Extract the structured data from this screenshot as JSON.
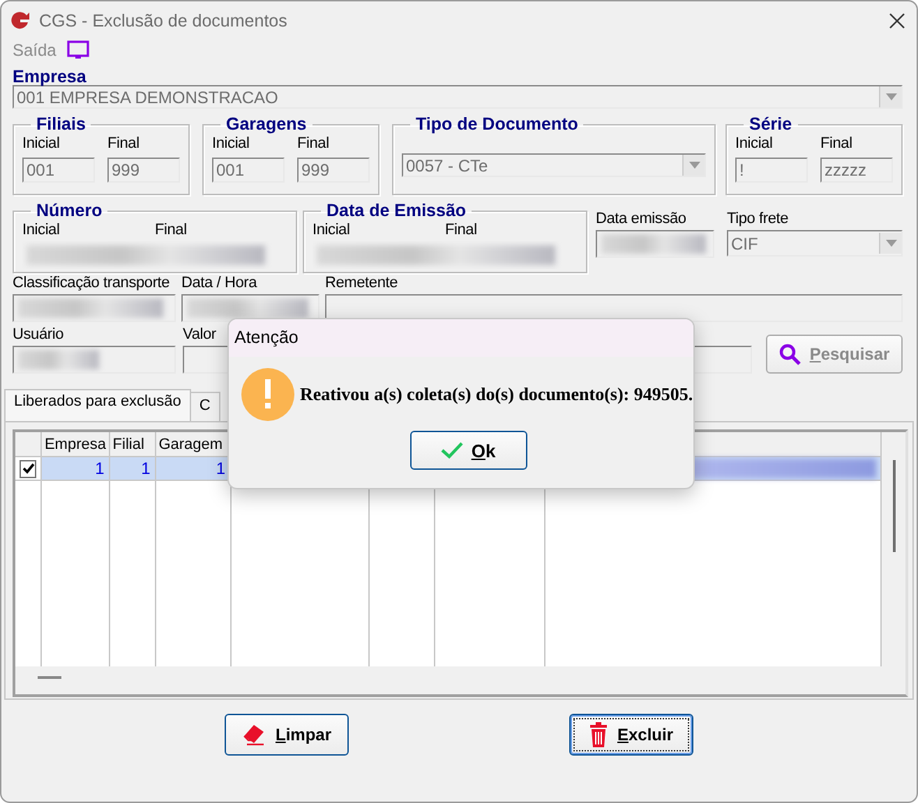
{
  "window": {
    "title": "CGS - Exclusão de documentos"
  },
  "menu": [
    {
      "label": "Saída"
    }
  ],
  "empresa": {
    "label": "Empresa",
    "value": "001 EMPRESA DEMONSTRACAO"
  },
  "ranges": [
    {
      "title": "Filiais",
      "fields": [
        {
          "label": "Inicial",
          "value": "001"
        },
        {
          "label": "Final",
          "value": "999"
        }
      ]
    },
    {
      "title": "Garagens",
      "fields": [
        {
          "label": "Inicial",
          "value": "001"
        },
        {
          "label": "Final",
          "value": "999"
        }
      ]
    }
  ],
  "tipo_documento": {
    "title": "Tipo de Documento",
    "value": "0057 - CTe"
  },
  "serie": {
    "title": "Série",
    "fields": [
      {
        "label": "Inicial",
        "value": "!"
      },
      {
        "label": "Final",
        "value": "zzzzz"
      }
    ]
  },
  "numero": {
    "title": "Número",
    "fields": [
      {
        "label": "Inicial"
      },
      {
        "label": "Final"
      }
    ]
  },
  "data_emissao_range": {
    "title": "Data de Emissão",
    "fields": [
      {
        "label": "Inicial"
      },
      {
        "label": "Final"
      }
    ]
  },
  "data_emissao": {
    "label": "Data emissão"
  },
  "tipo_frete": {
    "label": "Tipo frete",
    "value": "CIF"
  },
  "row_fields": [
    {
      "label": "Classificação transporte"
    },
    {
      "label": "Data / Hora"
    },
    {
      "label": "Remetente"
    }
  ],
  "usuario": {
    "label": "Usuário"
  },
  "valor": {
    "label": "Valor"
  },
  "search_button": "Pesquisar",
  "tabs": [
    {
      "label": "Liberados para exclusão",
      "selected": true
    },
    {
      "label": "C",
      "selected": false
    }
  ],
  "table": {
    "columns": [
      "Empresa",
      "Filial",
      "Garagem"
    ],
    "rows": [
      {
        "checked": true,
        "selected": true,
        "cells": [
          "1",
          "1",
          "1"
        ]
      }
    ]
  },
  "buttons": [
    {
      "label": "Limpar",
      "kind": "eraser",
      "focused": false
    },
    {
      "label": "Excluir",
      "kind": "trash",
      "focused": true
    }
  ],
  "dialog": {
    "title": "Atenção",
    "message": "Reativou a(s) coleta(s) do(s) documento(s): 949505.",
    "button": "Ok"
  }
}
